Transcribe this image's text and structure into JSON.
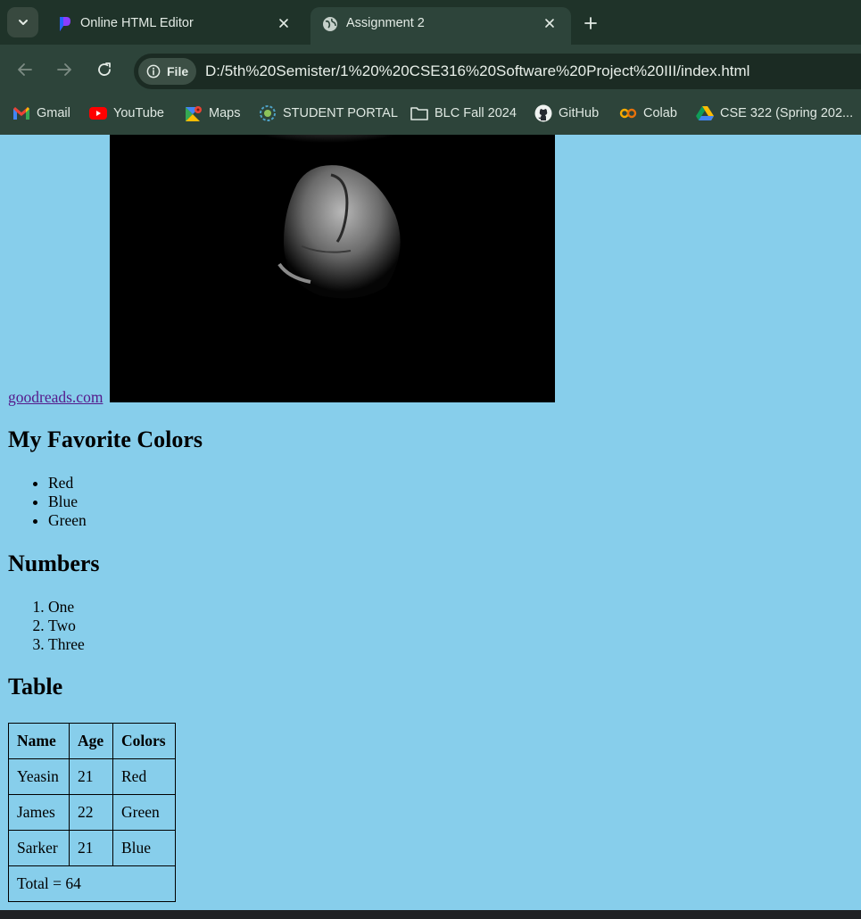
{
  "browser": {
    "tabs": [
      {
        "title": "Online HTML Editor",
        "active": false,
        "icon": "editor-logo-icon"
      },
      {
        "title": "Assignment 2",
        "active": true,
        "icon": "globe-icon"
      }
    ],
    "address_bar": {
      "security_chip": "File",
      "url": "D:/5th%20Semister/1%20%20CSE316%20Software%20Project%20III/index.html"
    },
    "bookmarks": [
      {
        "label": "Gmail",
        "icon": "gmail-icon"
      },
      {
        "label": "YouTube",
        "icon": "youtube-icon"
      },
      {
        "label": "Maps",
        "icon": "maps-icon"
      },
      {
        "label": "STUDENT PORTAL",
        "icon": "portal-icon"
      },
      {
        "label": "BLC Fall 2024",
        "icon": "folder-icon"
      },
      {
        "label": "GitHub",
        "icon": "github-icon"
      },
      {
        "label": "Colab",
        "icon": "colab-icon"
      },
      {
        "label": "CSE 322 (Spring 202...",
        "icon": "drive-icon"
      }
    ],
    "colors": {
      "tab_strip": "#1f3329",
      "toolbar": "#2d443a",
      "page_background": "#87ceeb",
      "visited_link": "#551a8b"
    }
  },
  "page": {
    "link_text": "goodreads.com",
    "colors_heading": "My Favorite Colors",
    "colors_list": [
      "Red",
      "Blue",
      "Green"
    ],
    "numbers_heading": "Numbers",
    "numbers_list": [
      "One",
      "Two",
      "Three"
    ],
    "table_heading": "Table",
    "table": {
      "headers": [
        "Name",
        "Age",
        "Colors"
      ],
      "rows": [
        [
          "Yeasin",
          "21",
          "Red"
        ],
        [
          "James",
          "22",
          "Green"
        ],
        [
          "Sarker",
          "21",
          "Blue"
        ]
      ],
      "footer": "Total = 64"
    }
  }
}
